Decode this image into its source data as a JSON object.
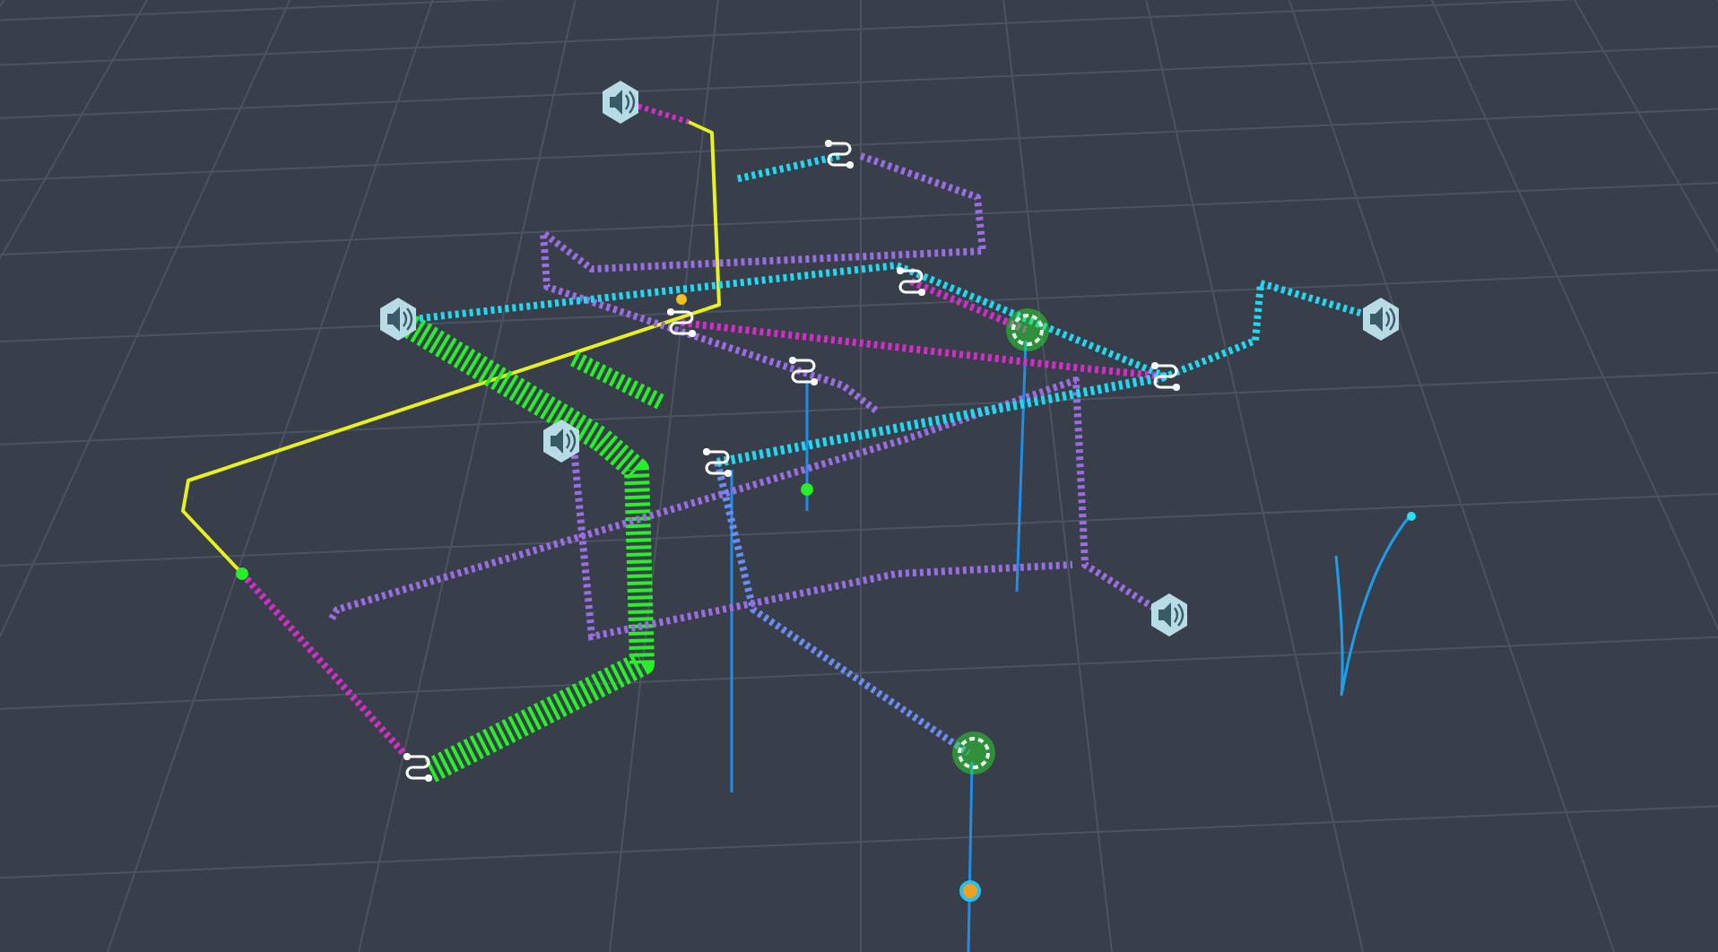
{
  "scene": {
    "paths": [
      {
        "color": "#d42ec8"
      },
      {
        "color": "#e8f020"
      },
      {
        "color": "#9a6ee0"
      },
      {
        "color": "#22d8f0"
      },
      {
        "color": "#28f028"
      },
      {
        "color": "#d42ec8"
      },
      {
        "color": "#9a6ee0"
      },
      {
        "color": "#22d8f0"
      },
      {
        "color": "#6a8ef0"
      }
    ]
  }
}
